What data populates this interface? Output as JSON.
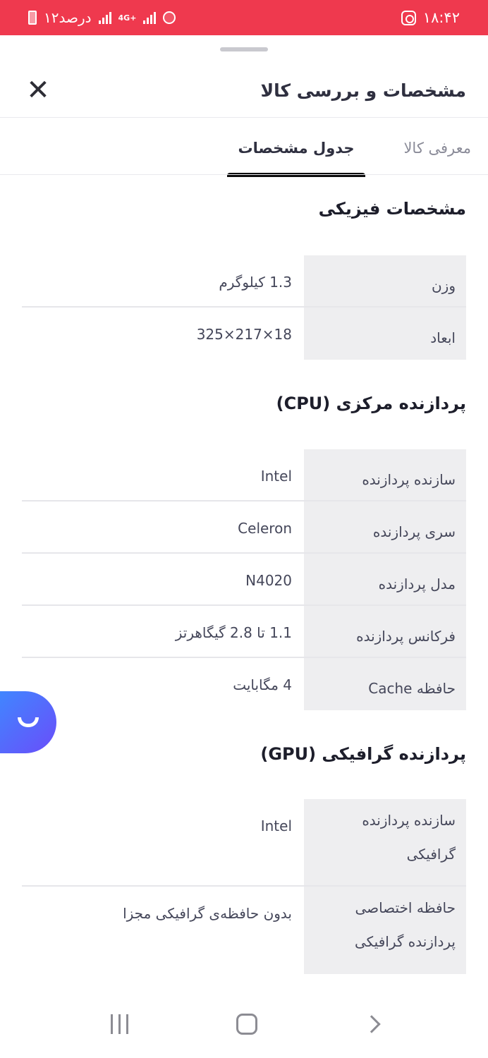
{
  "status_bar": {
    "time": "۱۸:۴۲",
    "battery_label": "۱۲درصد",
    "network_label": "4G+"
  },
  "header": {
    "title": "مشخصات و بررسی کالا"
  },
  "tabs": [
    {
      "label": "معرفی کالا"
    },
    {
      "label": "جدول مشخصات"
    }
  ],
  "sections": [
    {
      "title": "مشخصات فیزیکی",
      "rows": [
        {
          "key": "وزن",
          "value": "1.3 کیلوگرم"
        },
        {
          "key": "ابعاد",
          "value": "325×217×18"
        }
      ]
    },
    {
      "title": "پردازنده مرکزی (CPU)",
      "rows": [
        {
          "key": "سازنده پردازنده",
          "value": "Intel"
        },
        {
          "key": "سری پردازنده",
          "value": "Celeron"
        },
        {
          "key": "مدل پردازنده",
          "value": "N4020"
        },
        {
          "key": "فرکانس پردازنده",
          "value": "1.1 تا 2.8 گیگاهرتز"
        },
        {
          "key": "حافظه Cache",
          "value": "4 مگابایت"
        }
      ]
    },
    {
      "title": "پردازنده گرافیکی (GPU)",
      "rows": [
        {
          "key": "سازنده پردازنده گرافیکی",
          "value": "Intel"
        },
        {
          "key": "حافظه اختصاصی پردازنده گرافیکی",
          "value": "بدون حافظه‌ی گرافیکی مجزا"
        }
      ]
    }
  ]
}
